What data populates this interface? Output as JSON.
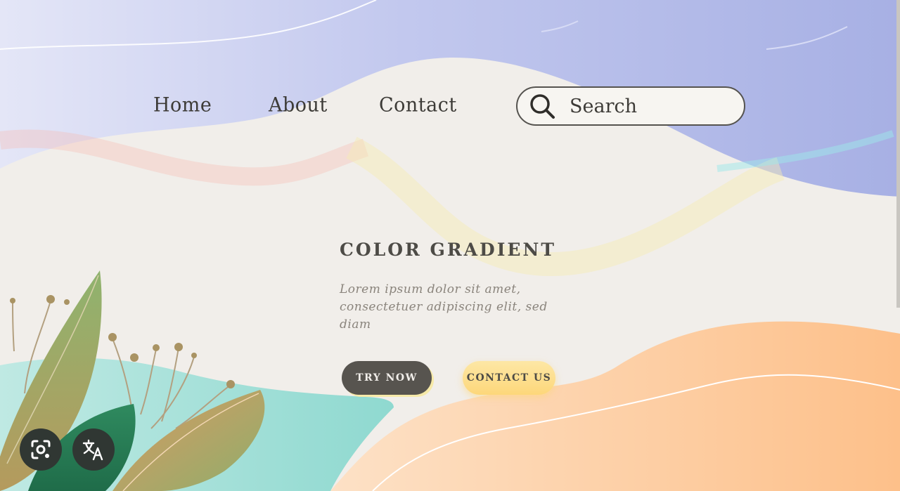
{
  "nav": {
    "items": [
      {
        "label": "Home"
      },
      {
        "label": "About"
      },
      {
        "label": "Contact"
      }
    ],
    "search": {
      "placeholder": "Search",
      "icon": "search-icon"
    }
  },
  "hero": {
    "title": "COLOR GRADIENT",
    "body_lines": [
      "Lorem ipsum dolor sit amet,",
      "consectetuer adipiscing elit, sed",
      "diam"
    ],
    "primary_button": "TRY NOW",
    "secondary_button": "CONTACT US"
  },
  "overlay_controls": [
    {
      "icon": "lens-icon"
    },
    {
      "icon": "translate-icon"
    }
  ],
  "colors": {
    "lavender": "#aeb5e8",
    "cream": "#f1eeea",
    "peach": "#fdc591",
    "teal": "#94dcd4",
    "dark_button": "#57544f",
    "yellow_button": "#fdd77a",
    "text_dark": "#3d3b37"
  }
}
